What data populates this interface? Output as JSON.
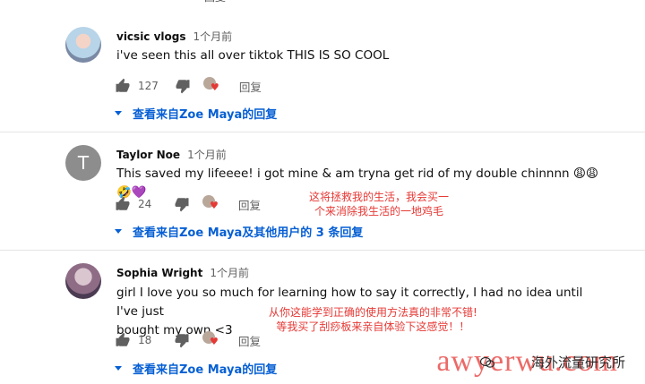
{
  "top_partial": {
    "reply_label": "回复"
  },
  "comments": [
    {
      "author": "vicsic vlogs",
      "time": "1个月前",
      "text": "i've seen this all over tiktok THIS IS SO COOL",
      "likes": "127",
      "reply_label": "回复",
      "view_replies": "查看来自Zoe Maya的回复"
    },
    {
      "author": "Taylor Noe",
      "avatar_letter": "T",
      "time": "1个月前",
      "text": "This saved my lifeeee! i got mine & am tryna get rid of my double chinnnn 😩😩🤣💜",
      "likes": "24",
      "reply_label": "回复",
      "view_replies": "查看来自Zoe Maya及其他用户的 3 条回复",
      "annotation_line1": "这将拯救我的生活，我会买一",
      "annotation_line2": "个来消除我生活的一地鸡毛"
    },
    {
      "author": "Sophia Wright",
      "time": "1个月前",
      "text_line1": "girl I love you so much for learning how to say it correctly, I had no idea until I've just",
      "text_line2": "bought my own <3",
      "likes": "18",
      "reply_label": "回复",
      "view_replies": "查看来自Zoe Maya的回复",
      "annotation_line1": "从你这能学到正确的使用方法真的非常不错!",
      "annotation_line2": "等我买了刮痧板来亲自体验下这感觉！！"
    }
  ],
  "watermark": {
    "logo": "awyerwu.com",
    "text": "海外流量研究所"
  },
  "colors": {
    "link_blue": "#065fd4",
    "annotation_red": "#e53935",
    "heart_red": "#e53935"
  },
  "icons": [
    "thumbs-up-icon",
    "thumbs-down-icon",
    "creator-heart-icon",
    "caret-down-icon"
  ]
}
